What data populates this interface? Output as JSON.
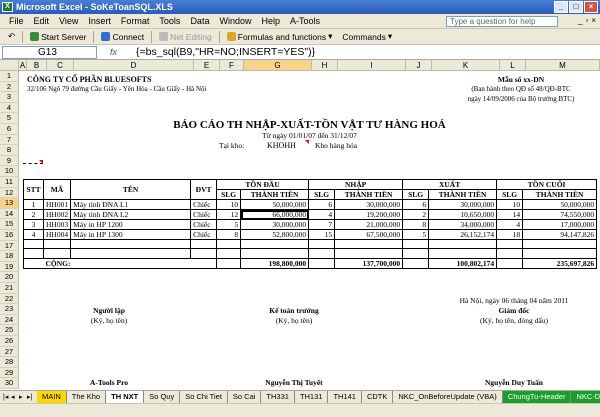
{
  "window": {
    "title": "Microsoft Excel - SoKeToanSQL.XLS"
  },
  "menu": {
    "items": [
      "File",
      "Edit",
      "View",
      "Insert",
      "Format",
      "Tools",
      "Data",
      "Window",
      "Help",
      "A-Tools"
    ],
    "help_placeholder": "Type a question for help"
  },
  "toolbar": {
    "start_server": "Start Server",
    "connect": "Connect",
    "net_editing": "Net Editing",
    "formulas": "Formulas and functions",
    "commands": "Commands"
  },
  "formula_bar": {
    "cell": "G13",
    "fx": "fx",
    "formula": "{=bs_sql(B9,\"HR=NO;INSERT=YES\")}"
  },
  "columns": [
    "A",
    "B",
    "C",
    "D",
    "E",
    "F",
    "G",
    "H",
    "I",
    "J",
    "K",
    "L",
    "M"
  ],
  "rows": [
    "1",
    "2",
    "3",
    "4",
    "5",
    "6",
    "7",
    "8",
    "9",
    "10",
    "11",
    "12",
    "13",
    "14",
    "15",
    "16",
    "17",
    "18",
    "19",
    "20",
    "21",
    "22",
    "23",
    "24",
    "25",
    "26",
    "27",
    "28",
    "29",
    "30"
  ],
  "sheet": {
    "company": "CÔNG TY CỔ PHẦN BLUESOFTS",
    "address": "32/106 Ngõ 79 đường Cầu Giấy - Yên Hòa - Cầu Giấy - Hà Nội",
    "form_no": "Mẫu số xx-DN",
    "decree1": "(Ban hành theo QĐ số 48/QĐ-BTC",
    "decree2": "ngày 14/09/2006 của Bộ trưởng BTC)",
    "report_title": "BÁO CÁO TH NHẬP-XUẤT-TỒN VẬT TƯ HÀNG HOÁ",
    "period": "Từ ngày 01/01/07 đến 31/12/07",
    "warehouse_label": "Tại kho:",
    "warehouse_code": "KHOHH",
    "warehouse_name": "Kho hàng hóa",
    "headers": {
      "stt": "STT",
      "ma": "MÃ",
      "ten": "TÊN",
      "dvt": "ĐVT",
      "ton_dau": "TỒN ĐẦU",
      "nhap": "NHẬP",
      "xuat": "XUẤT",
      "ton_cuoi": "TỒN CUỐI",
      "slg": "SLG",
      "thanh_tien": "THÀNH TIỀN"
    },
    "rows": [
      [
        "1",
        "HH001",
        "Máy tính ĐNA L1",
        "Chiếc",
        "10",
        "50,000,000",
        "6",
        "30,000,000",
        "6",
        "30,000,000",
        "10",
        "50,000,000"
      ],
      [
        "2",
        "HH002",
        "Máy tính ĐNA L2",
        "Chiếc",
        "12",
        "66,000,000",
        "4",
        "19,200,000",
        "2",
        "10,650,000",
        "14",
        "74,550,000"
      ],
      [
        "3",
        "HH003",
        "Máy in HP 1200",
        "Chiếc",
        "5",
        "30,000,000",
        "7",
        "21,000,000",
        "8",
        "34,000,000",
        "4",
        "17,000,000"
      ],
      [
        "4",
        "HH004",
        "Máy in HP 1300",
        "Chiếc",
        "8",
        "52,800,000",
        "15",
        "67,500,000",
        "5",
        "26,152,174",
        "18",
        "94,147,826"
      ]
    ],
    "total_label": "CỘNG:",
    "totals": [
      "198,800,000",
      "137,700,000",
      "100,802,174",
      "235,697,826"
    ],
    "date_line": "Hà Nội, ngày 06 tháng 04 năm 2011",
    "sig1_title": "Người lập",
    "sig1_note": "(Ký, họ tên)",
    "sig2_title": "Kế toán trưởng",
    "sig2_note": "(Ký, họ tên)",
    "sig3_title": "Giám đốc",
    "sig3_note": "(Ký, họ tên, đóng dấu)",
    "sig1_name": "A-Tools Pro",
    "sig2_name": "Nguyễn Thị Tuyết",
    "sig3_name": "Nguyễn Duy Tuấn"
  },
  "tabs": [
    "MAIN",
    "The Kho",
    "TH NXT",
    "So Quy",
    "So Chi Tiet",
    "So Cai",
    "TH331",
    "TH131",
    "TH141",
    "CDTK",
    "NKC_OnBeforeUpdate (VBA)",
    "ChungTu-Header",
    "NKC-Details"
  ],
  "colors": {
    "title_blue": "#2a5bb8",
    "selected_header": "#f8d38a",
    "tab_yellow": "#ffd700",
    "tab_green": "#1a9f2a"
  }
}
